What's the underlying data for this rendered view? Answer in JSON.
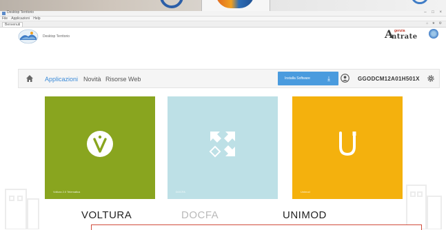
{
  "window": {
    "title": "Desktop Territorio",
    "menu": [
      "File",
      "Applicazioni",
      "Help"
    ],
    "tab": "Benvenuti",
    "tab_tools": "⌂ ★ ⚙",
    "controls": "– □ ×"
  },
  "header": {
    "app_name": "Desktop Territorio",
    "agency_logo_small": "genzia",
    "agency_logo_main": "ntrate",
    "agency_logo_letter": "A"
  },
  "nav": {
    "links": [
      {
        "label": "Applicazioni",
        "active": true
      },
      {
        "label": "Novità",
        "active": false
      },
      {
        "label": "Risorse Web",
        "active": false
      }
    ],
    "install_button": "Installa Software",
    "install_icon": "download-icon",
    "user_code": "GGODCM12A01H501X",
    "home_icon": "home-icon",
    "user_icon": "user-icon",
    "gear_icon": "gear-icon"
  },
  "tiles": [
    {
      "name": "VOLTURA",
      "caption": "Voltura 2.0 Telematica",
      "color": "#89a51f",
      "icon": "voltura-v-icon"
    },
    {
      "name": "DOCFA",
      "caption": "DOCFA",
      "color": "#bde0e6",
      "icon": "docfa-arrows-icon"
    },
    {
      "name": "UNIMOD",
      "caption": "Unimod",
      "color": "#f4b10d",
      "icon": "unimod-u-icon"
    }
  ],
  "colors": {
    "accent": "#4a9bde",
    "active_link": "#3a8ad8",
    "highlight_box": "#d04b3a"
  }
}
